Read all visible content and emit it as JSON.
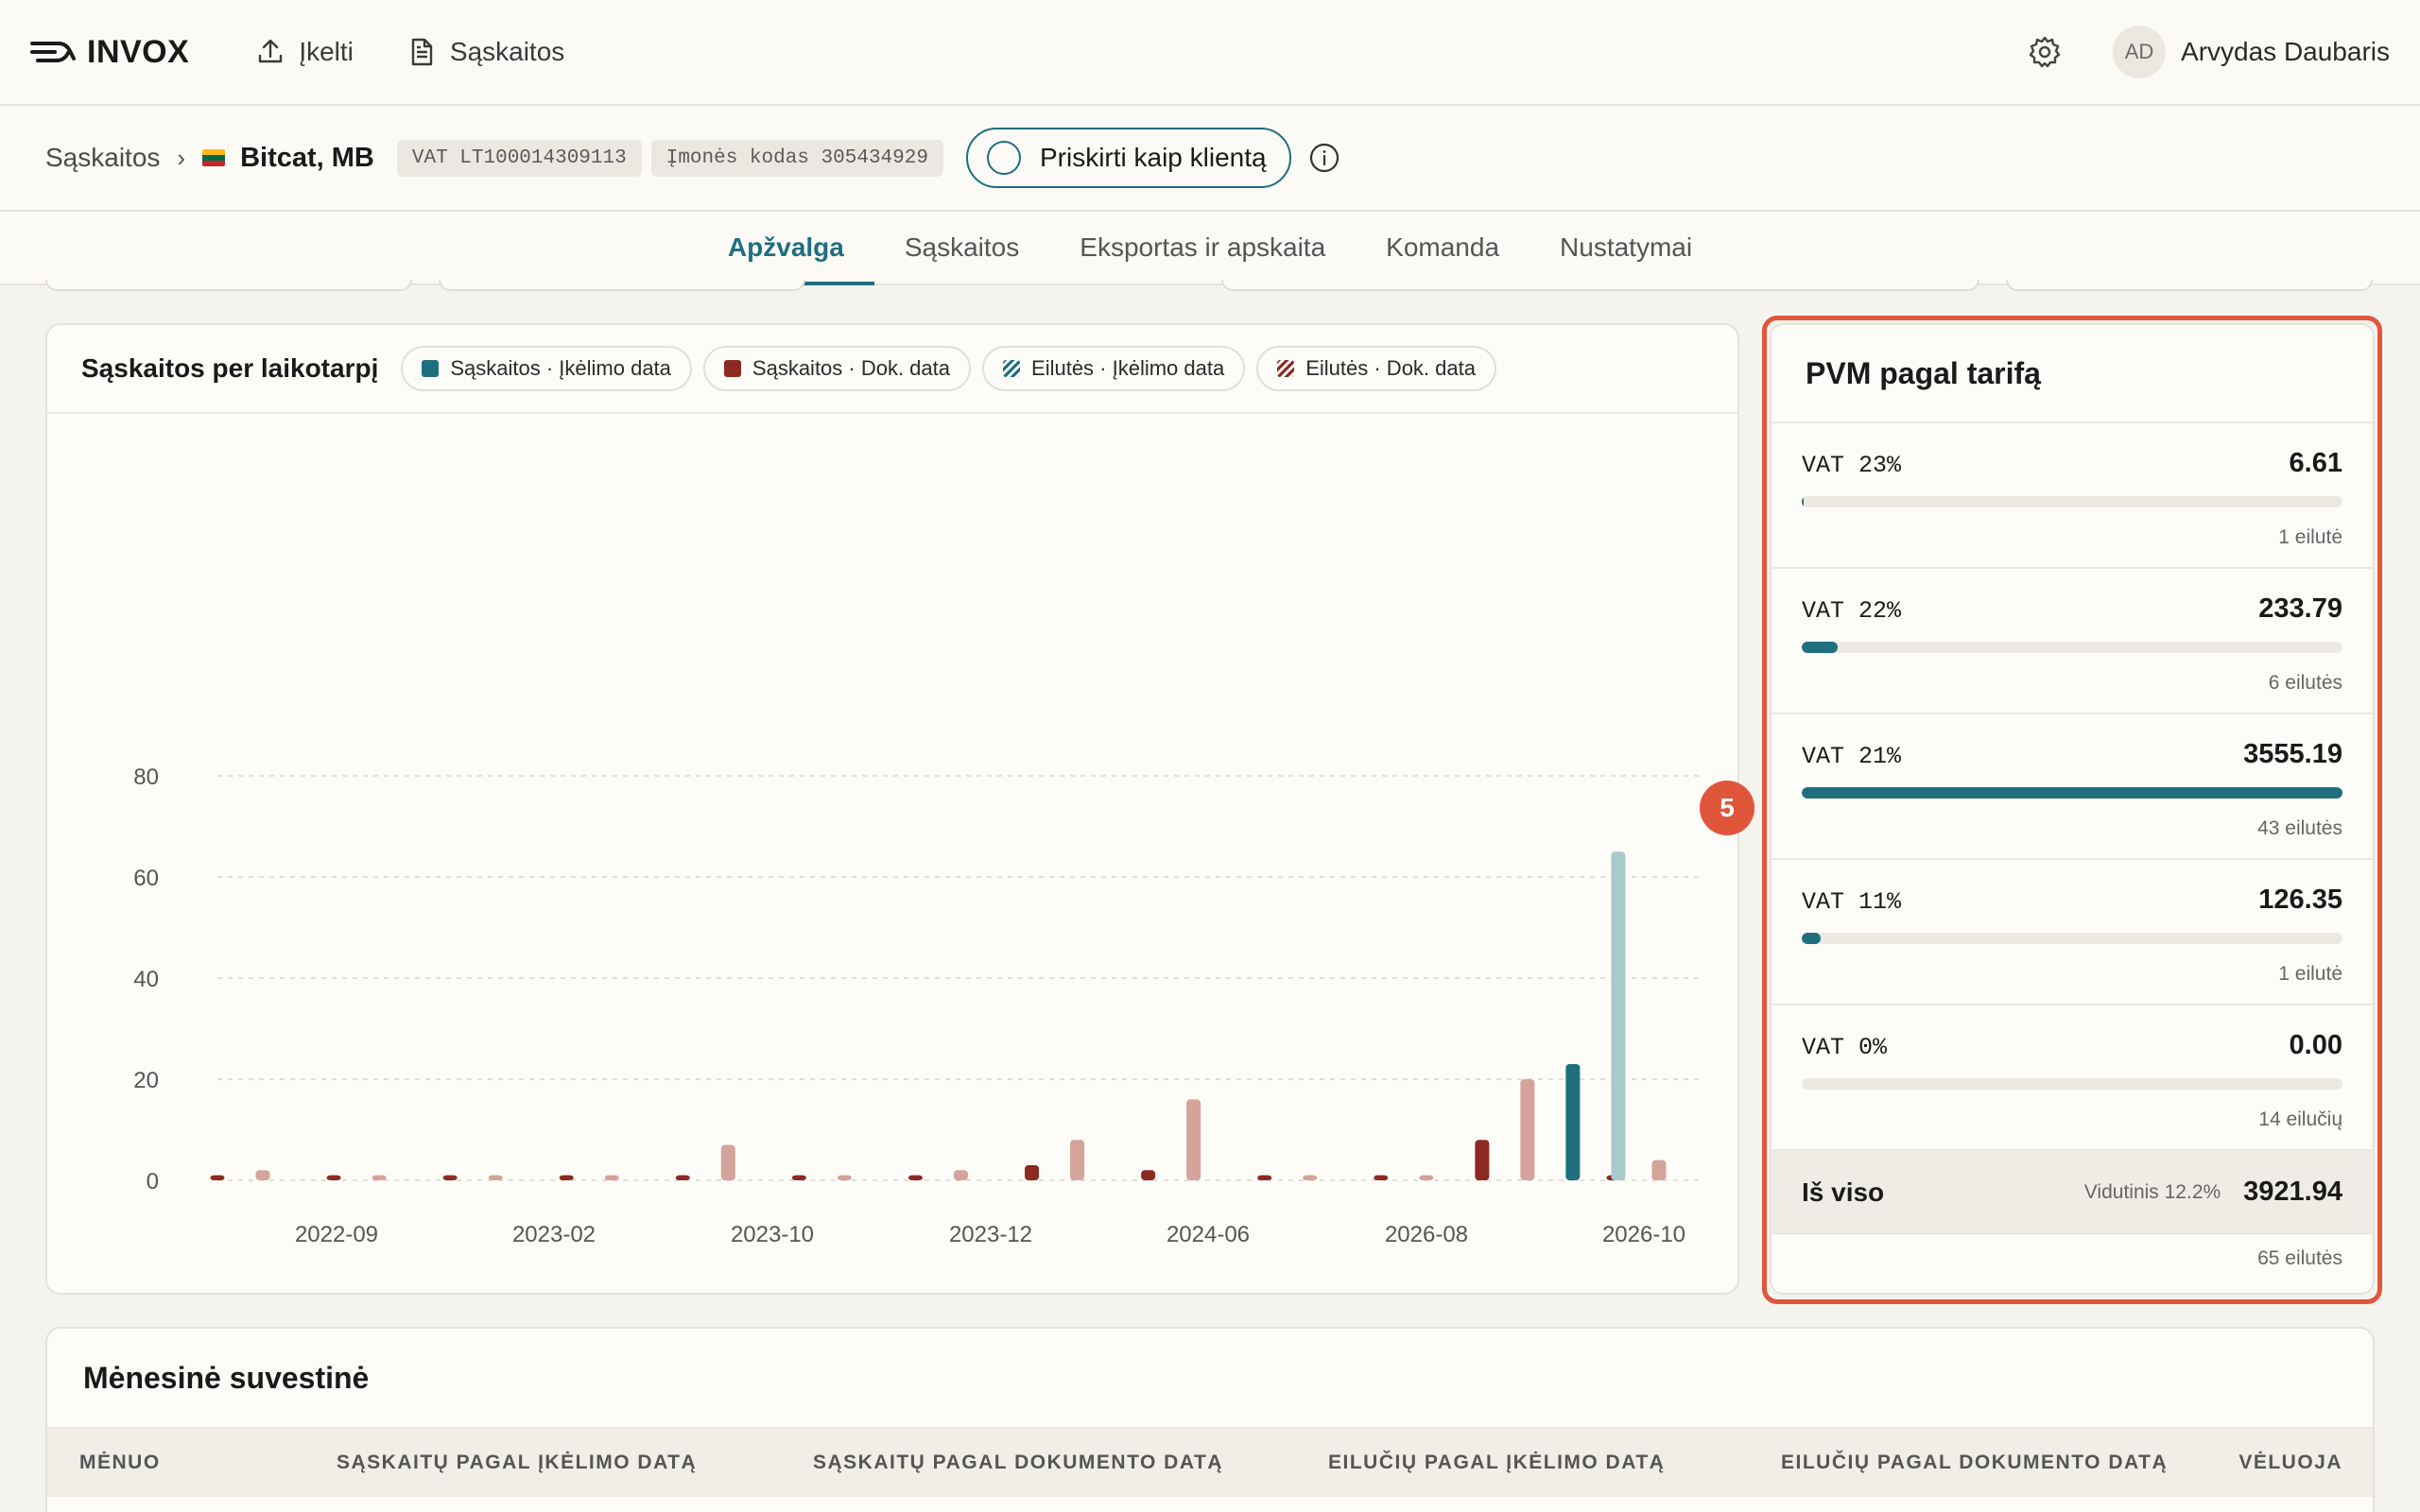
{
  "app": {
    "logo": "INVOX",
    "nav": {
      "upload": "Įkelti",
      "invoices": "Sąskaitos"
    },
    "user": {
      "initials": "AD",
      "name": "Arvydas Daubaris"
    }
  },
  "breadcrumb": {
    "root": "Sąskaitos",
    "company": "Bitcat, MB",
    "vat_code": "VAT LT100014309113",
    "company_code": "Įmonės kodas 305434929",
    "assign_label": "Priskirti kaip klientą"
  },
  "tabs": [
    "Apžvalga",
    "Sąskaitos",
    "Eksportas ir apskaita",
    "Komanda",
    "Nustatymai"
  ],
  "chart": {
    "title": "Sąskaitos per laikotarpį",
    "legend": [
      {
        "label": "Sąskaitos · Įkėlimo data",
        "color": "#1f6f7f",
        "pattern": "solid"
      },
      {
        "label": "Sąskaitos · Dok. data",
        "color": "#8b2a22",
        "pattern": "solid"
      },
      {
        "label": "Eilutės · Įkėlimo data",
        "color": "#1f6f7f",
        "pattern": "striped"
      },
      {
        "label": "Eilutės · Dok. data",
        "color": "#8b2a22",
        "pattern": "striped"
      }
    ]
  },
  "chart_data": {
    "type": "bar",
    "ylim": [
      0,
      80
    ],
    "yticks": [
      0,
      20,
      40,
      60,
      80
    ],
    "x_tick_labels": [
      "2022-09",
      "2023-02",
      "2023-10",
      "2023-12",
      "2024-06",
      "2026-08",
      "2026-10"
    ],
    "series": [
      {
        "name": "Sąskaitos · Dok. data",
        "color": "#8b2a22",
        "values": [
          1,
          1,
          1,
          1,
          1,
          1,
          1,
          3,
          2,
          1,
          1,
          8,
          1
        ]
      },
      {
        "name": "Eilutės · Dok. data",
        "color": "#d4a39a",
        "values": [
          2,
          1,
          1,
          1,
          7,
          1,
          2,
          8,
          16,
          1,
          1,
          20,
          4
        ]
      },
      {
        "name": "Sąskaitos · Įkėlimo data",
        "color": "#1f6f7f",
        "values": [
          0,
          0,
          0,
          0,
          0,
          0,
          0,
          0,
          0,
          0,
          0,
          23,
          0
        ]
      },
      {
        "name": "Eilutės · Įkėlimo data",
        "color": "#a9cacc",
        "values": [
          0,
          0,
          0,
          0,
          0,
          0,
          0,
          0,
          0,
          0,
          0,
          65,
          0
        ]
      }
    ]
  },
  "vat": {
    "title": "PVM pagal tarifą",
    "rows": [
      {
        "rate": "VAT 23%",
        "amount": "6.61",
        "share": 0.002,
        "count": "1 eilutė"
      },
      {
        "rate": "VAT 22%",
        "amount": "233.79",
        "share": 0.066,
        "count": "6 eilutės"
      },
      {
        "rate": "VAT 21%",
        "amount": "3555.19",
        "share": 1.0,
        "count": "43 eilutės"
      },
      {
        "rate": "VAT 11%",
        "amount": "126.35",
        "share": 0.035,
        "count": "1 eilutė"
      },
      {
        "rate": "VAT 0%",
        "amount": "0.00",
        "share": 0.0,
        "count": "14 eilučių"
      }
    ],
    "total_label": "Iš viso",
    "average": "Vidutinis 12.2%",
    "total_amount": "3921.94",
    "total_count": "65 eilutės"
  },
  "step_badge": "5",
  "summary": {
    "title": "Mėnesinė suvestinė",
    "columns": [
      "MĖNUO",
      "SĄSKAITŲ PAGAL ĮKĖLIMO DATĄ",
      "SĄSKAITŲ PAGAL DOKUMENTO DATĄ",
      "EILUČIŲ PAGAL ĮKĖLIMO DATĄ",
      "EILUČIŲ PAGAL DOKUMENTO DATĄ",
      "VĖLUOJA"
    ]
  },
  "colors": {
    "accent": "#1f6f7f",
    "highlight": "#e0563b",
    "doc_red": "#8b2a22"
  }
}
